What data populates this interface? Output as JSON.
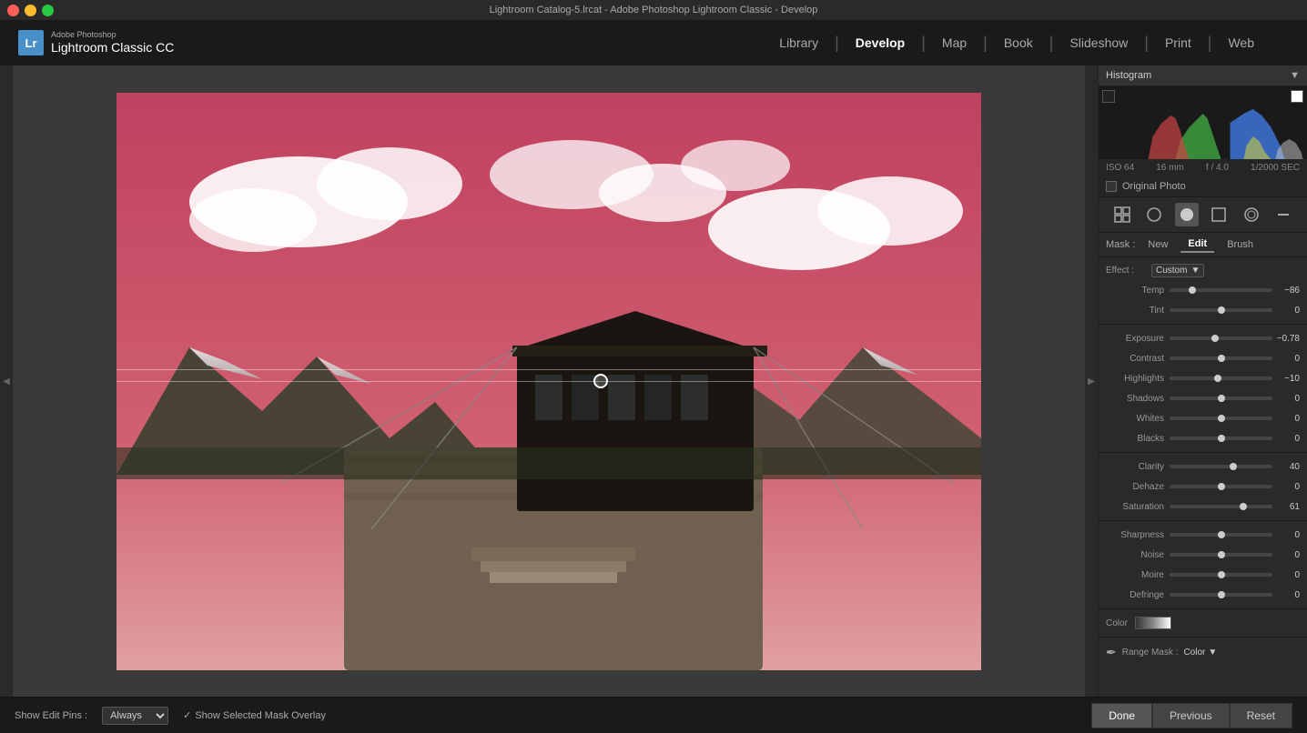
{
  "titlebar": {
    "title": "Lightroom Catalog-5.lrcat - Adobe Photoshop Lightroom Classic - Develop"
  },
  "logo": {
    "abbr": "Lr",
    "company": "Adobe Photoshop",
    "product": "Lightroom Classic CC"
  },
  "nav": {
    "items": [
      {
        "label": "Library",
        "active": false
      },
      {
        "label": "Develop",
        "active": true
      },
      {
        "label": "Map",
        "active": false
      },
      {
        "label": "Book",
        "active": false
      },
      {
        "label": "Slideshow",
        "active": false
      },
      {
        "label": "Print",
        "active": false
      },
      {
        "label": "Web",
        "active": false
      }
    ]
  },
  "histogram": {
    "panel_title": "Histogram",
    "exif": {
      "iso": "ISO 64",
      "focal": "16 mm",
      "aperture": "f / 4.0",
      "shutter": "1/2000 SEC"
    },
    "original_photo_label": "Original Photo"
  },
  "mask": {
    "label": "Mask :",
    "new_btn": "New",
    "edit_btn": "Edit",
    "brush_btn": "Brush"
  },
  "effect": {
    "label": "Effect :",
    "value": "Custom"
  },
  "adjustments": [
    {
      "label": "Temp",
      "value": "−86",
      "pct": 22,
      "color": "#4a7bc8",
      "negative": true
    },
    {
      "label": "Tint",
      "value": "0",
      "pct": 50,
      "color": "#888"
    },
    {
      "label": "Exposure",
      "value": "−0.78",
      "pct": 44,
      "color": "#888",
      "negative": true
    },
    {
      "label": "Contrast",
      "value": "0",
      "pct": 50,
      "color": "#888"
    },
    {
      "label": "Highlights",
      "value": "−10",
      "pct": 47,
      "color": "#888",
      "negative": true
    },
    {
      "label": "Shadows",
      "value": "0",
      "pct": 50,
      "color": "#888"
    },
    {
      "label": "Whites",
      "value": "0",
      "pct": 50,
      "color": "#888"
    },
    {
      "label": "Blacks",
      "value": "0",
      "pct": 50,
      "color": "#888"
    },
    {
      "label": "Clarity",
      "value": "40",
      "pct": 62,
      "color": "#888"
    },
    {
      "label": "Dehaze",
      "value": "0",
      "pct": 50,
      "color": "#888"
    },
    {
      "label": "Saturation",
      "value": "61",
      "pct": 72,
      "color": "#e05050"
    },
    {
      "label": "Sharpness",
      "value": "0",
      "pct": 50,
      "color": "#888"
    },
    {
      "label": "Noise",
      "value": "0",
      "pct": 50,
      "color": "#888"
    },
    {
      "label": "Moire",
      "value": "0",
      "pct": 50,
      "color": "#888"
    },
    {
      "label": "Defringe",
      "value": "0",
      "pct": 50,
      "color": "#888"
    }
  ],
  "color": {
    "label": "Color"
  },
  "range_mask": {
    "label": "Range Mask :",
    "value": "Color"
  },
  "bottom": {
    "edit_pins_label": "Show Edit Pins :",
    "edit_pins_value": "Always",
    "show_overlay_label": "Show Selected Mask Overlay",
    "done_btn": "Done",
    "previous_btn": "Previous",
    "reset_btn": "Reset"
  }
}
